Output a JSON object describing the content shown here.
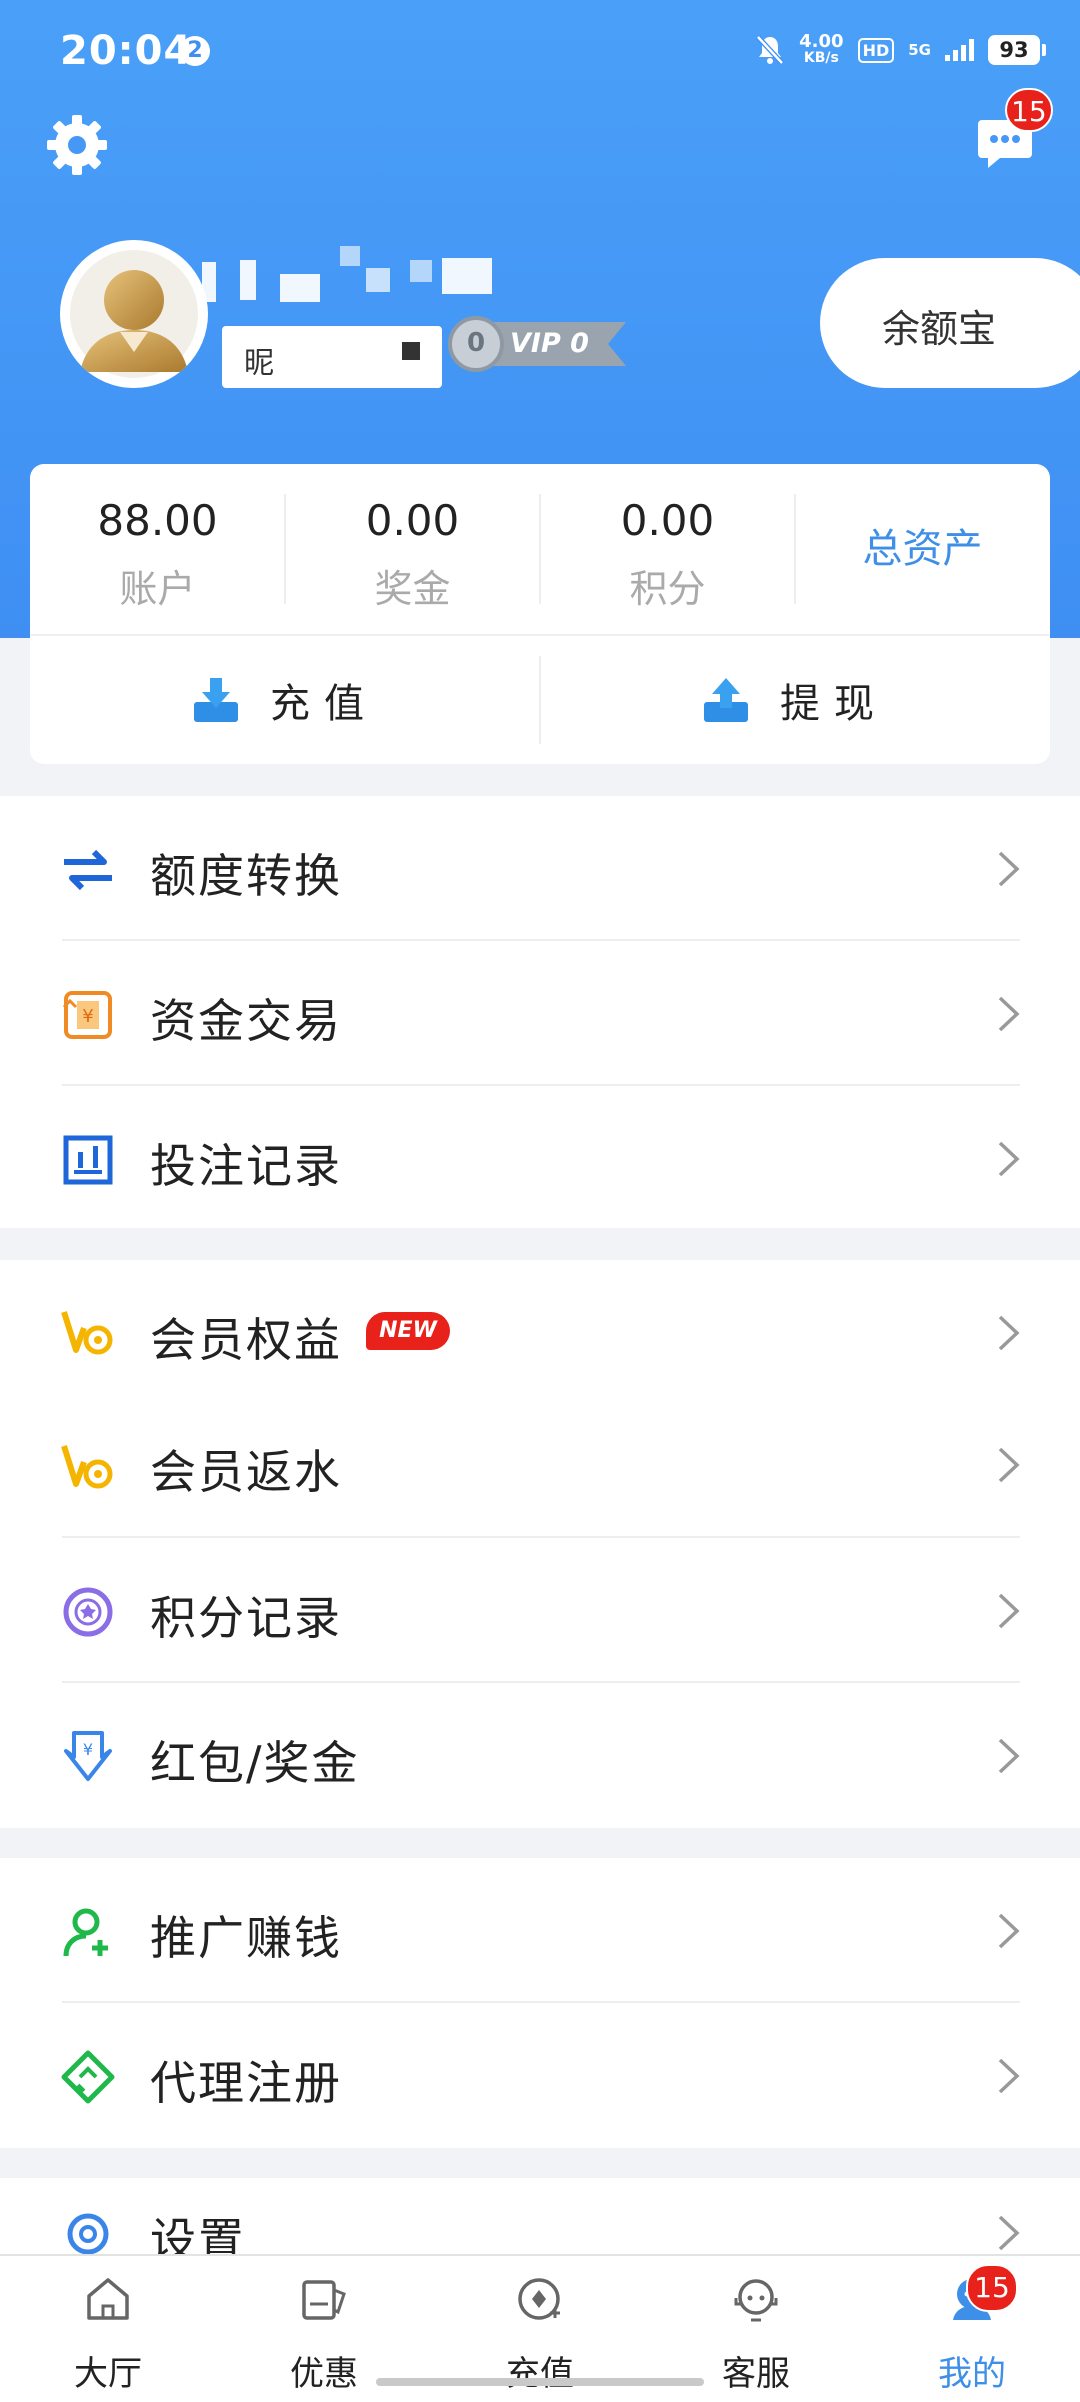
{
  "status_bar": {
    "time": "20:04",
    "notification_count": "2",
    "net_speed_value": "4.00",
    "net_speed_unit": "KB/s",
    "hd_label": "HD",
    "network_label": "5G",
    "battery": "93"
  },
  "header": {
    "message_badge": "15",
    "nickname_label": "昵",
    "vip_label": "VIP 0",
    "vip_level": "0",
    "balance_button": "余额宝"
  },
  "assets": {
    "account_value": "88.00",
    "account_label": "账户",
    "bonus_value": "0.00",
    "bonus_label": "奖金",
    "points_value": "0.00",
    "points_label": "积分",
    "total_assets": "总资产",
    "recharge": "充值",
    "withdraw": "提现"
  },
  "menu_group_1": [
    {
      "label": "额度转换",
      "icon": "transfer-icon"
    },
    {
      "label": "资金交易",
      "icon": "fund-trade-icon"
    },
    {
      "label": "投注记录",
      "icon": "bet-record-icon"
    }
  ],
  "menu_group_2": [
    {
      "label": "会员权益",
      "icon": "vip-icon",
      "badge": "NEW"
    },
    {
      "label": "会员返水",
      "icon": "vip-icon"
    },
    {
      "label": "积分记录",
      "icon": "points-icon"
    },
    {
      "label": "红包/奖金",
      "icon": "red-packet-icon"
    }
  ],
  "menu_group_3": [
    {
      "label": "推广赚钱",
      "icon": "promote-icon"
    },
    {
      "label": "代理注册",
      "icon": "agent-icon"
    }
  ],
  "menu_group_4": [
    {
      "label": "设置",
      "icon": "settings-icon"
    }
  ],
  "tab_bar": {
    "items": [
      {
        "label": "大厅",
        "icon": "home-icon"
      },
      {
        "label": "优惠",
        "icon": "promo-icon"
      },
      {
        "label": "充值",
        "icon": "recharge-icon"
      },
      {
        "label": "客服",
        "icon": "support-icon"
      },
      {
        "label": "我的",
        "icon": "profile-icon"
      }
    ],
    "active": "我的",
    "profile_badge": "15"
  },
  "colors": {
    "header_blue": "#4aa0f8",
    "accent_blue": "#3e8fe8",
    "badge_red": "#e8211b"
  }
}
